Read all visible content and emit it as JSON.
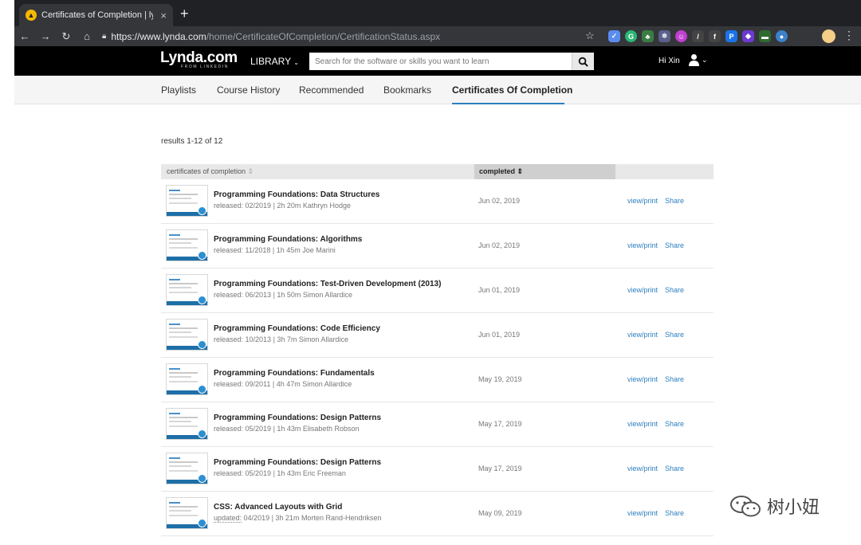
{
  "browser": {
    "tab_title": "Certificates of Completion | lyn",
    "url_host": "https://www.lynda.com",
    "url_path": "/home/CertificateOfCompletion/CertificationStatus.aspx"
  },
  "header": {
    "logo": "Lynda.com",
    "logo_sub": "FROM LINKEDIN",
    "library_label": "LIBRARY",
    "search_placeholder": "Search for the software or skills you want to learn",
    "greeting": "Hi Xin"
  },
  "subnav": {
    "items": [
      "Playlists",
      "Course History",
      "Recommended",
      "Bookmarks",
      "Certificates Of Completion"
    ]
  },
  "results_text": "results 1-12 of 12",
  "table": {
    "col_cert": "certificates of completion",
    "col_completed": "completed",
    "view_label": "view/print",
    "share_label": "Share",
    "rows": [
      {
        "title": "Programming Foundations: Data Structures",
        "meta_prefix": "released:",
        "meta": " 02/2019 | 2h 20m Kathryn Hodge",
        "date": "Jun 02, 2019"
      },
      {
        "title": "Programming Foundations: Algorithms",
        "meta_prefix": "released:",
        "meta": " 11/2018 | 1h 45m Joe Marini",
        "date": "Jun 02, 2019"
      },
      {
        "title": "Programming Foundations: Test-Driven Development (2013)",
        "meta_prefix": "released:",
        "meta": " 06/2013 | 1h 50m Simon Allardice",
        "date": "Jun 01, 2019"
      },
      {
        "title": "Programming Foundations: Code Efficiency",
        "meta_prefix": "released:",
        "meta": " 10/2013 | 3h 7m Simon Allardice",
        "date": "Jun 01, 2019"
      },
      {
        "title": "Programming Foundations: Fundamentals",
        "meta_prefix": "released:",
        "meta": " 09/2011 | 4h 47m Simon Allardice",
        "date": "May 19, 2019"
      },
      {
        "title": "Programming Foundations: Design Patterns",
        "meta_prefix": "released:",
        "meta": " 05/2019 | 1h 43m Elisabeth Robson",
        "date": "May 17, 2019"
      },
      {
        "title": "Programming Foundations: Design Patterns",
        "meta_prefix": "released:",
        "meta": " 05/2019 | 1h 43m Eric Freeman",
        "date": "May 17, 2019"
      },
      {
        "title": "CSS: Advanced Layouts with Grid",
        "meta_prefix": "updated:",
        "meta": " 04/2019 | 3h 21m Morten Rand-Hendriksen",
        "date": "May 09, 2019"
      }
    ]
  },
  "watermark": "树小妞"
}
